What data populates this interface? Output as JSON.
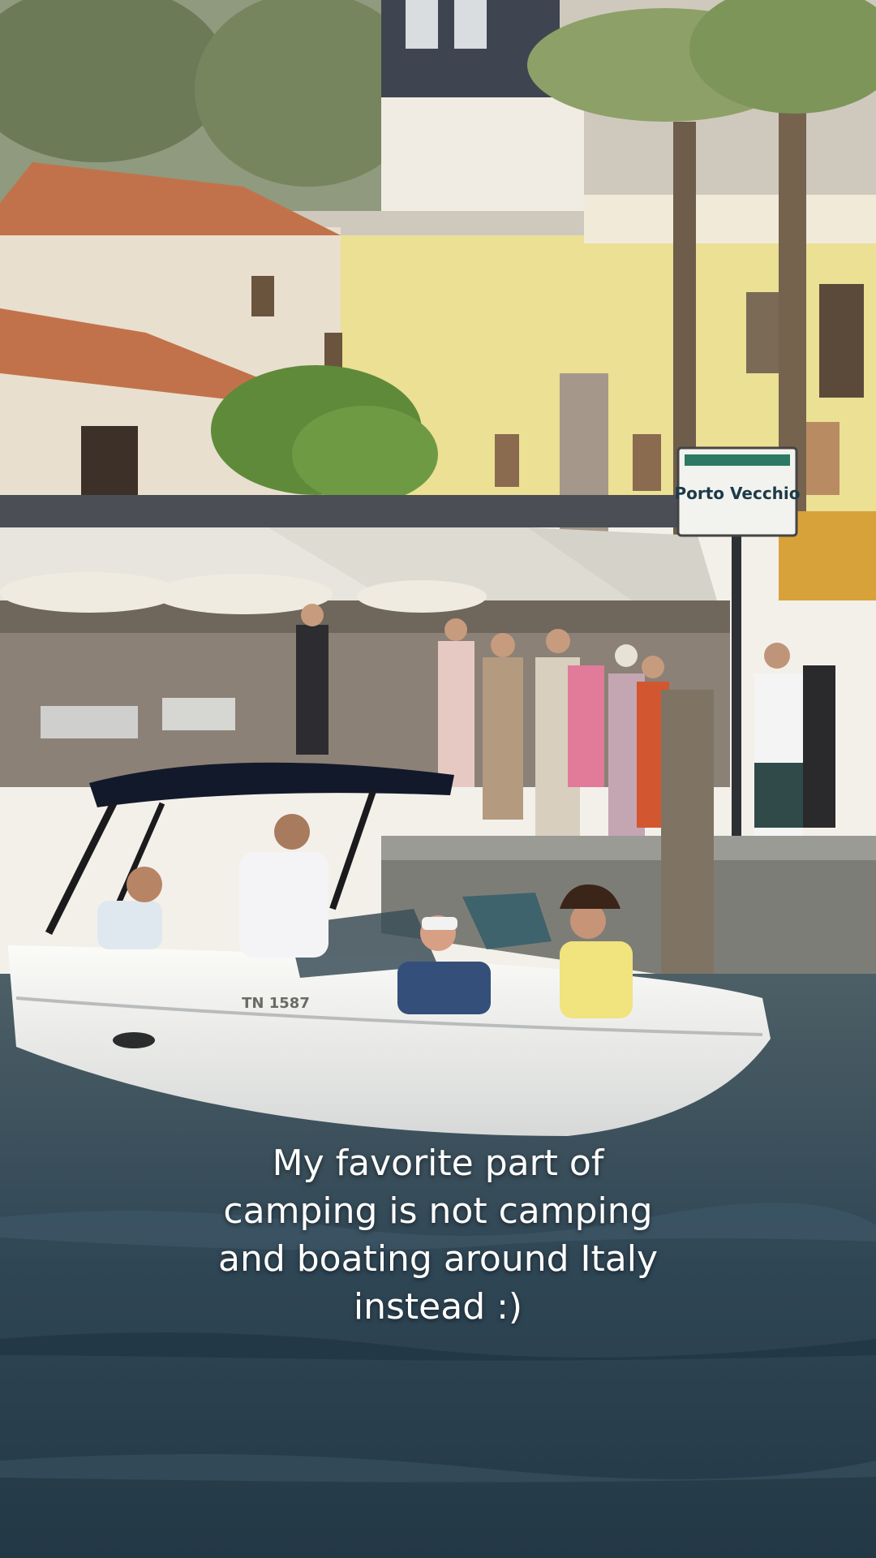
{
  "caption": {
    "line1": "My favorite part of",
    "line2": "camping is not camping",
    "line3": "and boating around Italy",
    "line4": "instead :)"
  },
  "sign": {
    "title": "Porto Vecchio"
  },
  "boat": {
    "registration": "TN 1587"
  },
  "colors": {
    "water": "#2f4655",
    "building_yellow": "#ebe093",
    "roof_terracotta": "#c2724a",
    "awning": "#e7e5de",
    "bimini": "#12192a",
    "hull": "#f4f4f2"
  }
}
